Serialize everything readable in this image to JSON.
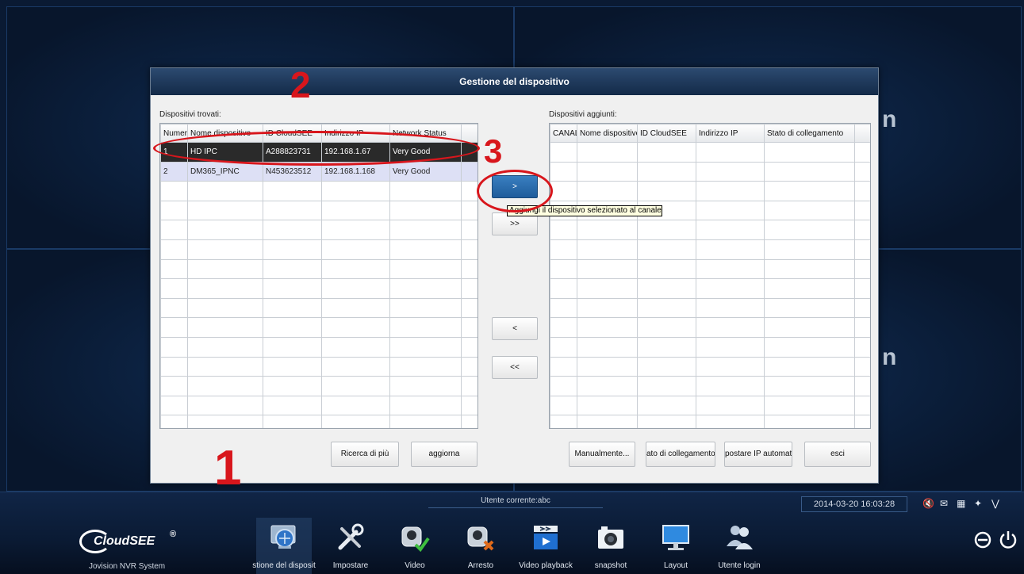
{
  "dialog": {
    "title": "Gestione del dispositivo",
    "found_label": "Dispositivi trovati:",
    "added_label": "Dispositivi aggiunti:",
    "found_columns": [
      "Numer",
      "Nome dispositivo",
      "ID CloudSEE",
      "Indirizzo IP",
      "Network Status"
    ],
    "found_rows": [
      [
        "1",
        "HD IPC",
        "A288823731",
        "192.168.1.67",
        "Very Good"
      ],
      [
        "2",
        "DM365_IPNC",
        "N453623512",
        "192.168.1.168",
        "Very Good"
      ]
    ],
    "added_columns": [
      "CANAL",
      "Nome dispositivo",
      "ID CloudSEE",
      "Indirizzo IP",
      "Stato di collegamento"
    ],
    "transfer_buttons": {
      "add_one": ">",
      "add_all": ">>",
      "remove_one": "<",
      "remove_all": "<<"
    },
    "tooltip": "Aggiungi il dispositivo selezionato al canale",
    "buttons": {
      "search_more": "Ricerca di più",
      "refresh": "aggiorna",
      "manual": "Manualmente...",
      "link_state": "ato di collegamento",
      "auto_ip": "postare IP automati",
      "exit": "esci"
    }
  },
  "annotations": [
    "1",
    "2",
    "3"
  ],
  "taskbar": {
    "current_user": "Utente corrente:abc",
    "datetime": "2014-03-20 16:03:28",
    "brand": "CloudSEE",
    "brand_mark": "®",
    "system_label": "Jovision NVR System",
    "items": [
      {
        "label": "stione del disposit",
        "icon": "device-management-icon"
      },
      {
        "label": "Impostare",
        "icon": "settings-tools-icon"
      },
      {
        "label": "Video",
        "icon": "video-camera-icon"
      },
      {
        "label": "Arresto",
        "icon": "stop-camera-icon"
      },
      {
        "label": "Video playback",
        "icon": "playback-icon"
      },
      {
        "label": "snapshot",
        "icon": "snapshot-camera-icon"
      },
      {
        "label": "Layout",
        "icon": "monitor-icon"
      },
      {
        "label": "Utente login",
        "icon": "users-icon"
      }
    ]
  },
  "colors": {
    "annotation": "#d8161c",
    "title_bar": "#1c3a5e",
    "selected_row": "#2a2a2a"
  }
}
